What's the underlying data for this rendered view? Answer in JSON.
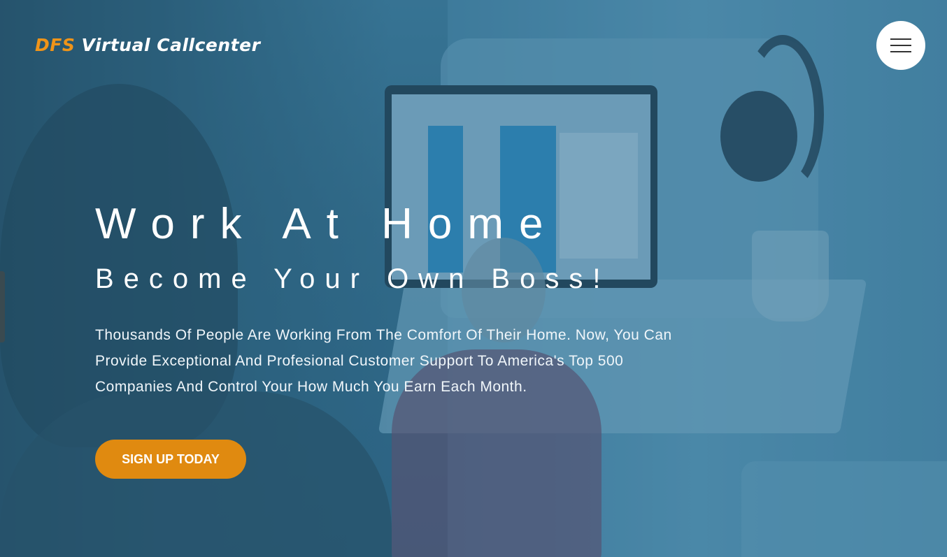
{
  "header": {
    "logo_part1": "DFS",
    "logo_part2": " Virtual Callcenter",
    "menu_icon": "hamburger-menu-icon"
  },
  "hero": {
    "title": "Work At Home",
    "subtitle": "Become Your Own Boss!",
    "description": "Thousands Of People Are Working From The Comfort Of Their Home. Now, You Can Provide Exceptional And Profesional Customer Support To America's Top 500 Companies And Control Your How Much You Earn Each Month.",
    "cta_label": "SIGN UP TODAY"
  },
  "colors": {
    "accent": "#e08a10",
    "logo_accent": "#ef9419",
    "overlay": "#35708f",
    "text": "#ffffff"
  }
}
